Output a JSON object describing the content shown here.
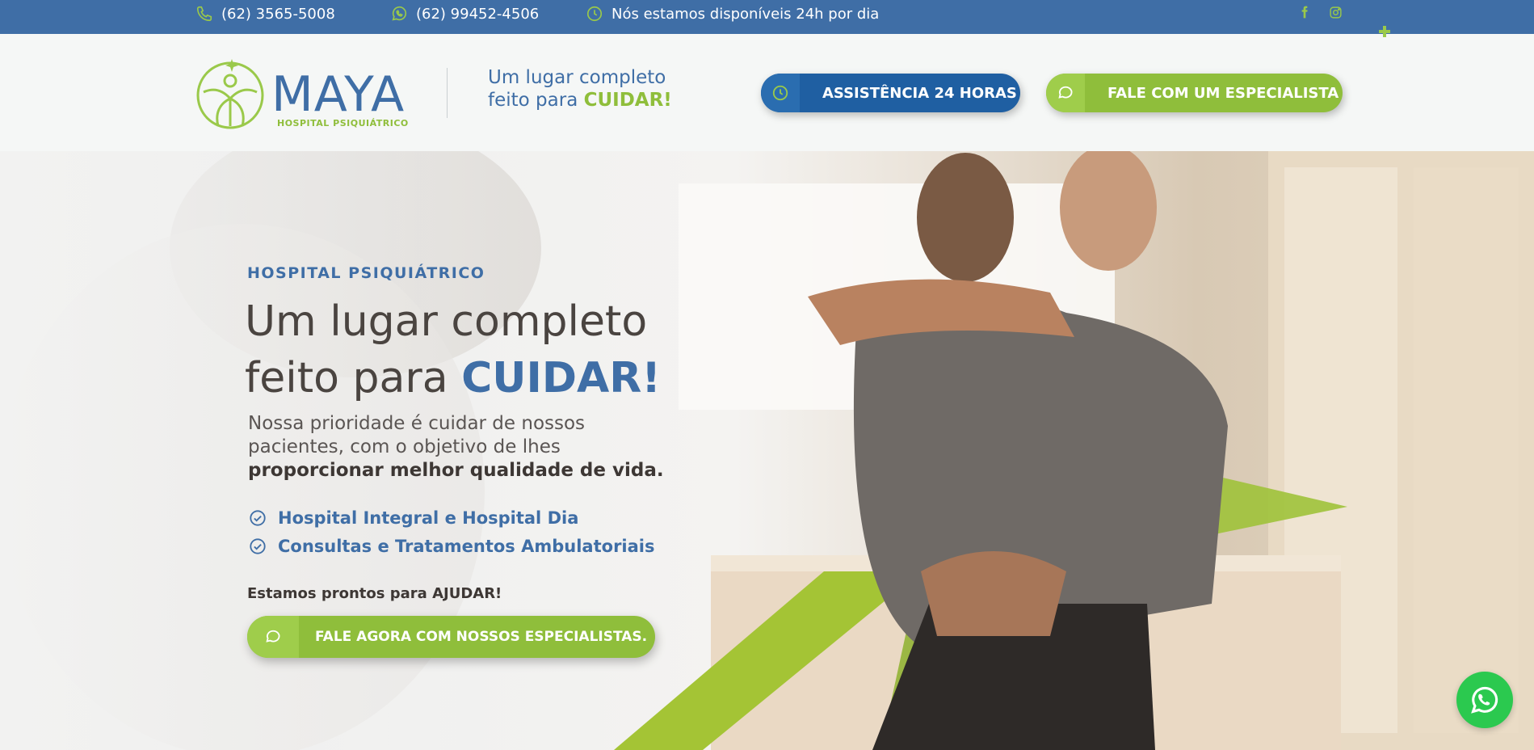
{
  "topbar": {
    "phone": "(62) 3565-5008",
    "whatsapp": "(62) 99452-4506",
    "availability": "Nós estamos disponíveis 24h por dia",
    "icons": [
      "phone-icon",
      "whatsapp-icon",
      "clock-icon",
      "facebook-icon",
      "instagram-icon"
    ]
  },
  "header": {
    "logo_text": "MAYA",
    "logo_subtitle": "HOSPITAL PSIQUIÁTRICO",
    "slogan_line1": "Um lugar completo",
    "slogan_line2_prefix": "feito para ",
    "slogan_line2_accent": "CUIDAR!",
    "btn_assistance": "ASSISTÊNCIA 24 HORAS",
    "btn_specialist": "FALE COM UM ESPECIALISTA"
  },
  "hero": {
    "tag": "HOSPITAL PSIQUIÁTRICO",
    "title_line1": "Um lugar completo",
    "title_line2_prefix": "feito para ",
    "title_line2_strong": "CUIDAR!",
    "paragraph_line1": "Nossa prioridade é cuidar de nossos",
    "paragraph_line2": "pacientes, com o objetivo de lhes",
    "paragraph_bold": "proporcionar melhor qualidade de vida.",
    "features": [
      "Hospital Integral e Hospital Dia",
      "Consultas e Tratamentos Ambulatoriais"
    ],
    "ready_text": "Estamos prontos para AJUDAR!",
    "cta_label": "FALE AGORA COM NOSSOS ESPECIALISTAS."
  },
  "colors": {
    "brand_blue": "#3f6ea6",
    "brand_green": "#8fbe3b",
    "whatsapp_green": "#2bc94f"
  }
}
